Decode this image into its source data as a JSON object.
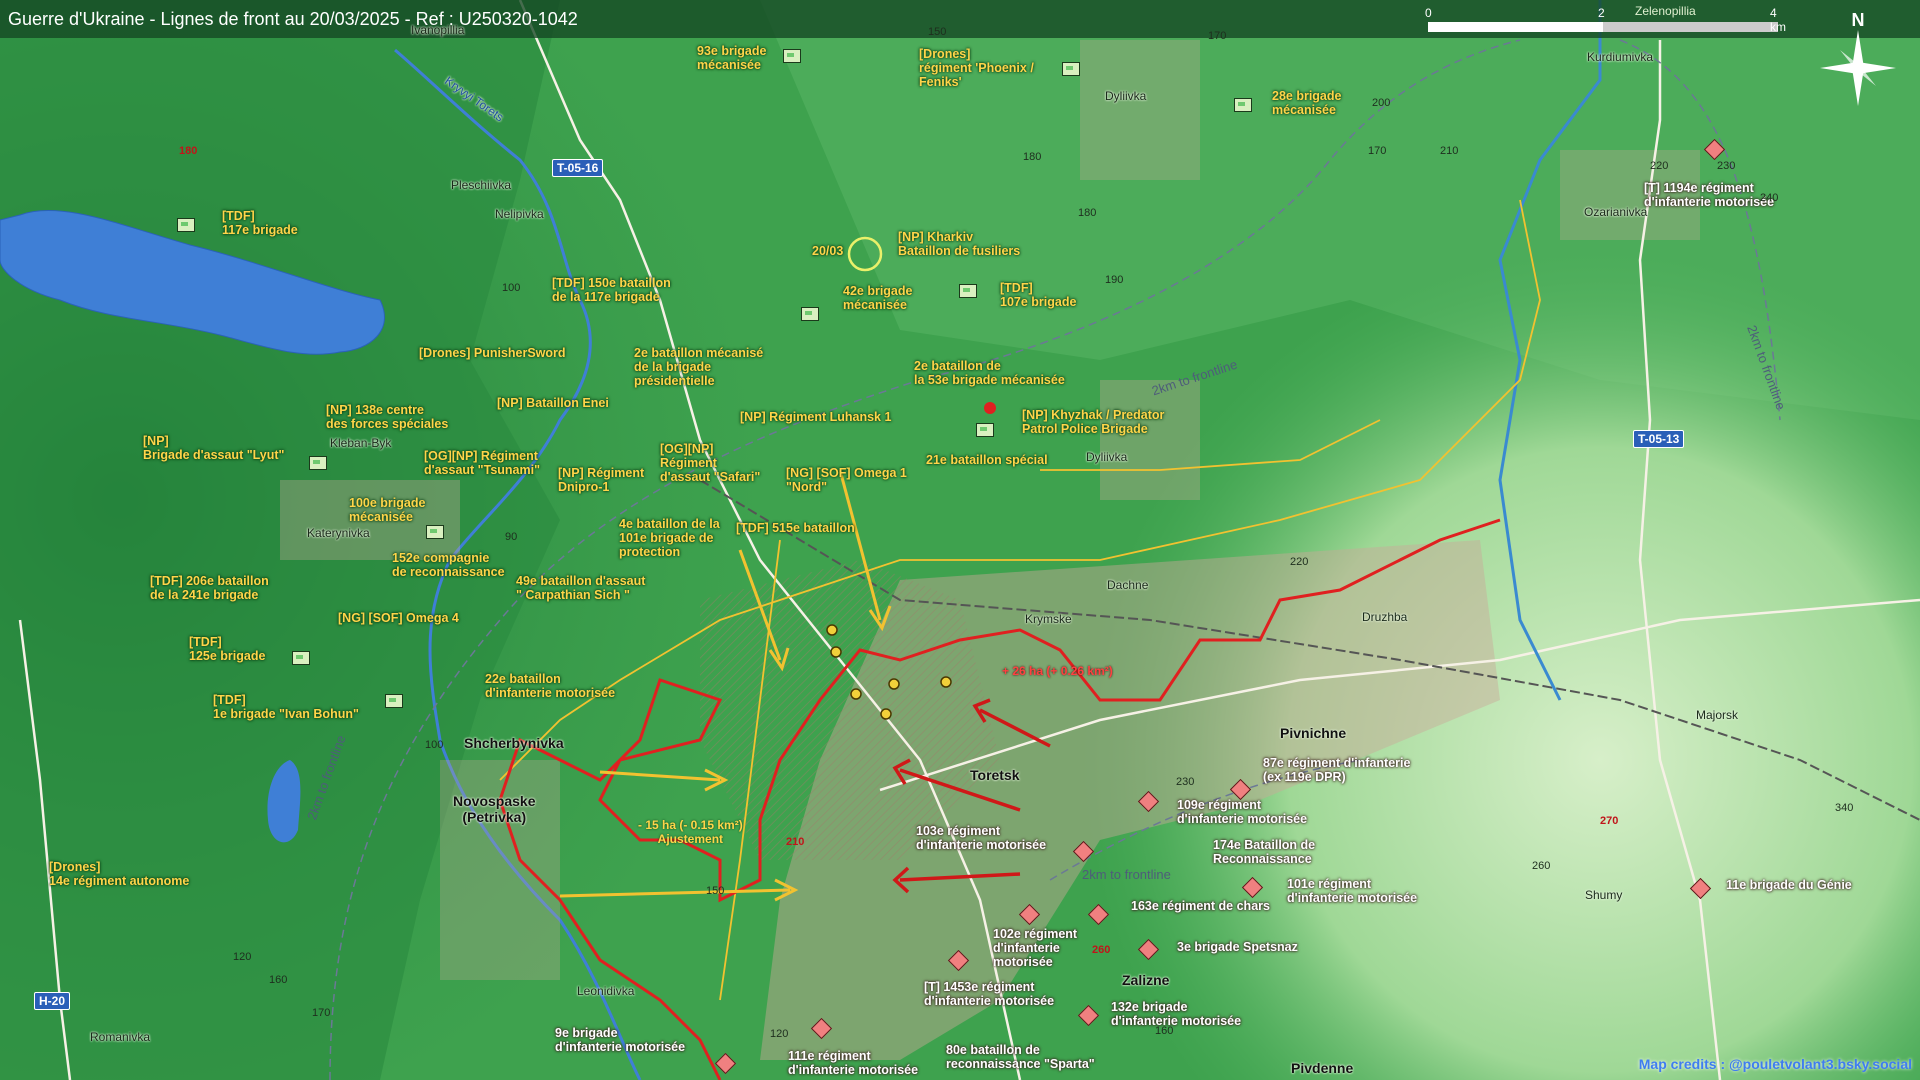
{
  "header": {
    "title": "Guerre d'Ukraine - Lignes de front au 20/03/2025 - Ref : U250320-1042",
    "scale_labels": [
      "0",
      "2",
      "4 km"
    ],
    "scale_place": "Zelenopillia",
    "north_label": "N"
  },
  "colors": {
    "ukrainian_units": "#ffd54a",
    "russian_units": "#ffffff",
    "front_line": "#e02020",
    "ua_arrows": "#f2c230",
    "ru_arrows": "#d01818",
    "road_badge": "#2a5fb8"
  },
  "ukrainian_units": [
    {
      "label": "93e brigade\nmécanisée",
      "icon": "brigade-symbol"
    },
    {
      "label": "[Drones]\nrégiment 'Phoenix /\nFeniks'",
      "icon": "regiment-symbol"
    },
    {
      "label": "28e brigade\nmécanisée",
      "icon": "brigade-symbol"
    },
    {
      "label": "[TDF]\n117e brigade",
      "icon": "brigade-symbol"
    },
    {
      "label": "[NP] Kharkiv\nBataillon de fusiliers",
      "icon": "battalion-symbol"
    },
    {
      "label": "[TDF] 150e bataillon\nde la 117e brigade",
      "icon": "battalion-symbol"
    },
    {
      "label": "42e brigade\nmécanisée",
      "icon": "brigade-symbol"
    },
    {
      "label": "[TDF]\n107e brigade",
      "icon": "brigade-symbol"
    },
    {
      "label": "[Drones] PunisherSword",
      "icon": "unit-symbol"
    },
    {
      "label": "2e bataillon mécanisé\nde la brigade\nprésidentielle",
      "icon": "battalion-symbol"
    },
    {
      "label": "2e bataillon de\nla 53e brigade mécanisée",
      "icon": "battalion-symbol"
    },
    {
      "label": "[NP] 138e centre\ndes forces spéciales",
      "icon": "unit-symbol"
    },
    {
      "label": "[NP] Bataillon Enei",
      "icon": "battalion-symbol"
    },
    {
      "label": "[NP] Régiment Luhansk 1",
      "icon": "regiment-symbol"
    },
    {
      "label": "[NP] Khyzhak / Predator\nPatrol Police Brigade",
      "icon": "brigade-symbol"
    },
    {
      "label": "[NP]\nBrigade d'assaut \"Lyut\"",
      "icon": "brigade-symbol"
    },
    {
      "label": "[OG][NP] Régiment\nd'assaut \"Tsunami\"",
      "icon": "regiment-symbol"
    },
    {
      "label": "[NP] Régiment\nDnipro-1",
      "icon": "regiment-symbol"
    },
    {
      "label": "[OG][NP]\nRégiment\nd'assaut \"Safari\"",
      "icon": "regiment-symbol"
    },
    {
      "label": "[NG] [SOF] Omega 1\n\"Nord\"",
      "icon": "unit-symbol"
    },
    {
      "label": "21e bataillon spécial",
      "icon": "battalion-symbol"
    },
    {
      "label": "100e brigade\nmécanisée",
      "icon": "brigade-symbol"
    },
    {
      "label": "4e bataillon de la\n101e brigade de\nprotection",
      "icon": "battalion-symbol"
    },
    {
      "label": "[TDF] 515e bataillon",
      "icon": "battalion-symbol"
    },
    {
      "label": "152e compagnie\nde reconnaissance",
      "icon": "company-symbol"
    },
    {
      "label": "[TDF] 206e bataillon\nde la 241e brigade",
      "icon": "battalion-symbol"
    },
    {
      "label": "49e bataillon d'assaut\n\" Carpathian Sich \"",
      "icon": "battalion-symbol"
    },
    {
      "label": "[NG] [SOF] Omega 4",
      "icon": "unit-symbol"
    },
    {
      "label": "[TDF]\n125e brigade",
      "icon": "brigade-symbol"
    },
    {
      "label": "22e bataillon\nd'infanterie motorisée",
      "icon": "battalion-symbol"
    },
    {
      "label": "[TDF]\n1e brigade \"Ivan Bohun\"",
      "icon": "brigade-symbol"
    },
    {
      "label": "[Drones]\n14e régiment autonome",
      "icon": "regiment-symbol"
    }
  ],
  "russian_units": [
    {
      "label": "[T] 1194e régiment\nd'infanterie motorisée",
      "icon": "regiment-symbol"
    },
    {
      "label": "87e régiment d'infanterie\n(ex 119e DPR)",
      "icon": "regiment-symbol"
    },
    {
      "label": "109e régiment\nd'infanterie motorisée",
      "icon": "regiment-symbol"
    },
    {
      "label": "174e Bataillon de\nReconnaissance",
      "icon": "battalion-symbol"
    },
    {
      "label": "103e régiment\nd'infanterie motorisée",
      "icon": "regiment-symbol"
    },
    {
      "label": "101e régiment\nd'infanterie motorisée",
      "icon": "regiment-symbol"
    },
    {
      "label": "11e brigade du Génie",
      "icon": "brigade-symbol"
    },
    {
      "label": "163e régiment de chars",
      "icon": "regiment-symbol"
    },
    {
      "label": "102e régiment\nd'infanterie\nmotorisée",
      "icon": "regiment-symbol"
    },
    {
      "label": "3e brigade Spetsnaz",
      "icon": "brigade-symbol"
    },
    {
      "label": "[T] 1453e régiment\nd'infanterie motorisée",
      "icon": "regiment-symbol"
    },
    {
      "label": "132e brigade\nd'infanterie motorisée",
      "icon": "brigade-symbol"
    },
    {
      "label": "9e brigade\nd'infanterie motorisée",
      "icon": "brigade-symbol"
    },
    {
      "label": "111e régiment\nd'infanterie motorisée",
      "icon": "regiment-symbol"
    },
    {
      "label": "80e bataillon de\nreconnaissance \"Sparta\"",
      "icon": "battalion-symbol"
    }
  ],
  "places": [
    "Ivanopillia",
    "Pleschiivka",
    "Nelipivka",
    "Kleban-Byk",
    "Katerynivka",
    "Dyliivka",
    "Dyliivka",
    "Kurdiumivka",
    "Ozarianivka",
    "Dachne",
    "Krymske",
    "Druzhba",
    "Majorsk",
    "Shumy",
    "Leonidivka",
    "Romanivka"
  ],
  "big_places": [
    "Shcherbynivka",
    "Novospaske\n(Petrivka)",
    "Toretsk",
    "Pivnichne",
    "Zalizne",
    "Pivdenne"
  ],
  "water": [
    "Kryvyi Torets"
  ],
  "roads": [
    "T-05-16",
    "T-05-13",
    "H-20"
  ],
  "elevations": [
    "150",
    "170",
    "180",
    "170",
    "200",
    "210",
    "220",
    "230",
    "240",
    "180",
    "190",
    "100",
    "90",
    "100",
    "160",
    "170",
    "120",
    "150",
    "220",
    "230",
    "260",
    "340",
    "120",
    "160"
  ],
  "red_elevations": [
    "180",
    "210",
    "270",
    "260"
  ],
  "annotations": {
    "date_marker": "20/03",
    "gain": "+ 26 ha (+ 0.26 km²)",
    "loss": "- 15 ha (- 0.15 km²)\nAjustement",
    "frontline_distance_1": "2km to frontline",
    "frontline_distance_2": "2km to frontline",
    "frontline_distance_3": "2km to frontline",
    "frontline_distance_4": "2km to frontline"
  },
  "footer": {
    "credit": "Map credits : @pouletvolant3.bsky.social"
  }
}
